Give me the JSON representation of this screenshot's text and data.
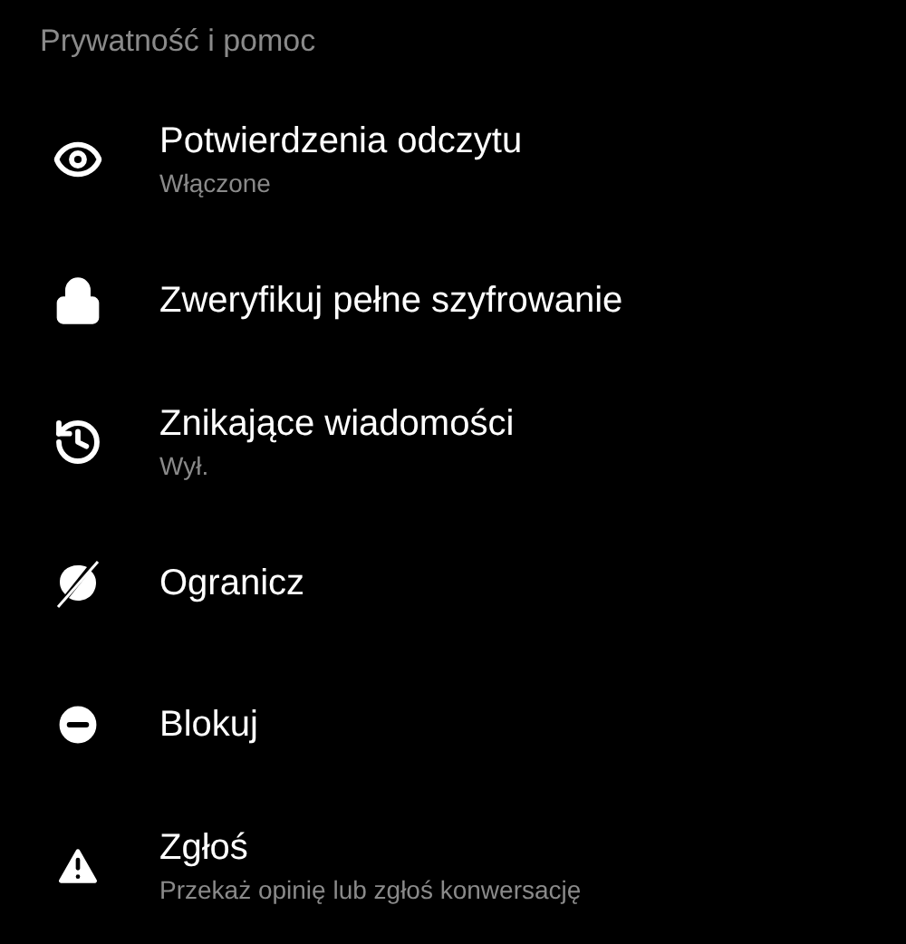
{
  "section": {
    "title": "Prywatność i pomoc"
  },
  "items": [
    {
      "label": "Potwierdzenia odczytu",
      "subtitle": "Włączone"
    },
    {
      "label": "Zweryfikuj pełne szyfrowanie"
    },
    {
      "label": "Znikające wiadomości",
      "subtitle": "Wył."
    },
    {
      "label": "Ogranicz"
    },
    {
      "label": "Blokuj"
    },
    {
      "label": "Zgłoś",
      "subtitle": "Przekaż opinię lub zgłoś konwersację"
    }
  ]
}
